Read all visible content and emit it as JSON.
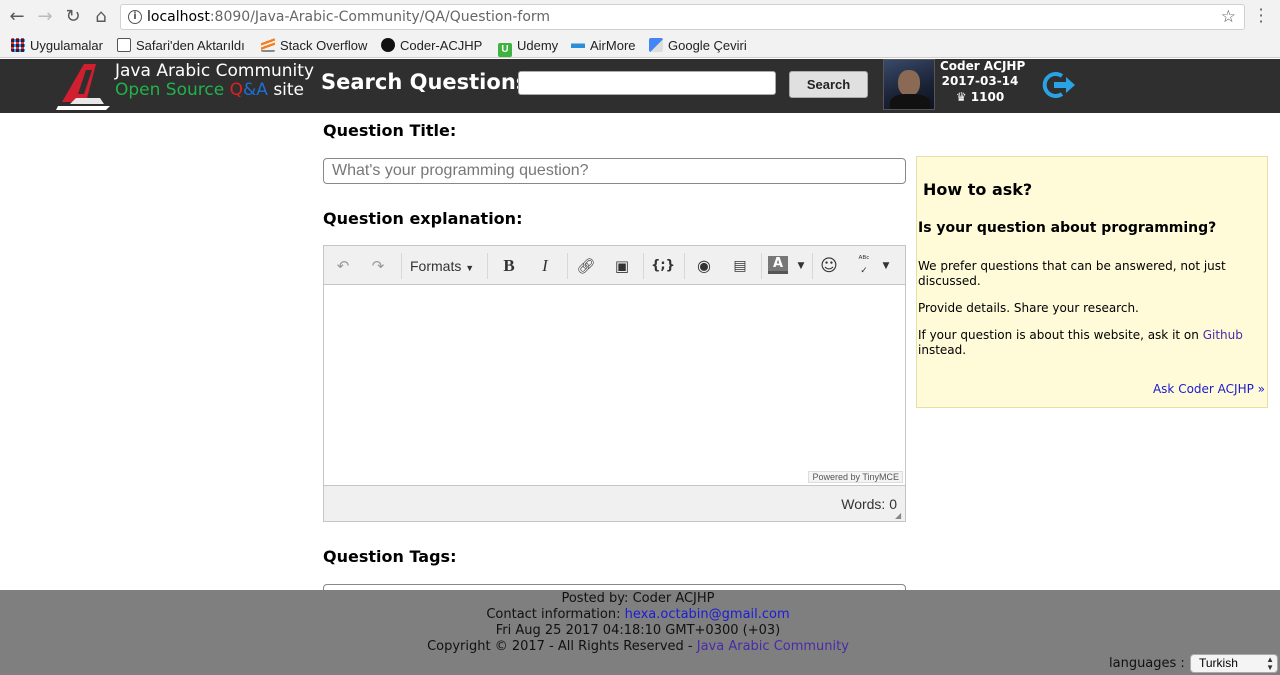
{
  "browser": {
    "url_host": "localhost",
    "url_rest": ":8090/Java-Arabic-Community/QA/Question-form",
    "bookmarks": [
      {
        "label": "Uygulamalar",
        "icon": "apps-grid-icon"
      },
      {
        "label": "Safari'den Aktarıldı",
        "icon": "folder-icon"
      },
      {
        "label": "Stack Overflow",
        "icon": "stackoverflow-icon"
      },
      {
        "label": "Coder-ACJHP",
        "icon": "github-icon"
      },
      {
        "label": "Udemy",
        "icon": "udemy-icon"
      },
      {
        "label": "AirMore",
        "icon": "airmore-icon"
      },
      {
        "label": "Google Çeviri",
        "icon": "google-translate-icon"
      }
    ]
  },
  "header": {
    "title_line1": "Java Arabic Community",
    "title_open_source": "Open Source",
    "title_q": "Q",
    "title_amp": "&",
    "title_a": "A",
    "title_site": "site",
    "search_label": "Search Questions :",
    "search_value": "",
    "search_button": "Search",
    "user": {
      "name": "Coder ACJHP",
      "date": "2017-03-14",
      "reputation": "♛ 1100"
    }
  },
  "form": {
    "title_label": "Question Title:",
    "title_placeholder": "What's your programming question?",
    "explanation_label": "Question explanation:",
    "editor": {
      "formats_label": "Formats",
      "powered_by": "Powered by TinyMCE",
      "words": "Words: 0"
    },
    "tags_label": "Question Tags:"
  },
  "help": {
    "title": "How to ask?",
    "subtitle": "Is your question about programming?",
    "p1": "We prefer questions that can be answered, not just discussed.",
    "p2": "Provide details. Share your research.",
    "p3_before": "If your question is about this website, ask it on ",
    "p3_link": "Github",
    "p3_after": "instead.",
    "ask_link": "Ask Coder ACJHP »"
  },
  "footer": {
    "posted_by": "Posted by: Coder ACJHP",
    "contact_label": "Contact information: ",
    "contact_email": "hexa.octabin@gmail.com",
    "date": "Fri Aug 25 2017 04:18:10 GMT+0300 (+03)",
    "copyright": "Copyright © 2017 - All Rights Reserved - ",
    "community_link": "Java Arabic Community",
    "languages_label": "languages :",
    "language_selected": "Turkish"
  }
}
